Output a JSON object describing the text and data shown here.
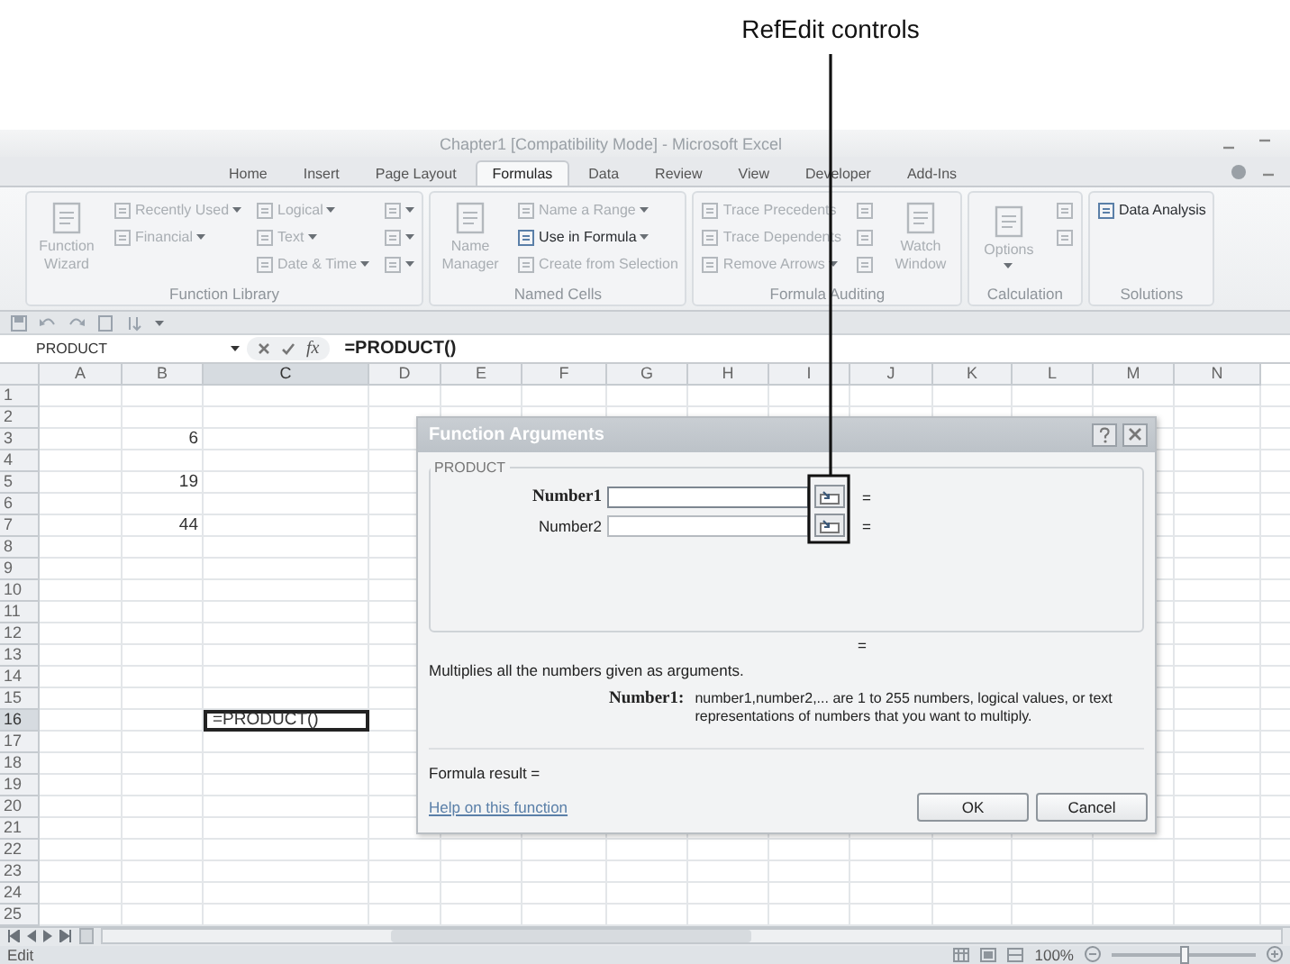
{
  "annotation": {
    "text": "RefEdit controls"
  },
  "window": {
    "title": "Chapter1  [Compatibility Mode] - Microsoft Excel"
  },
  "ribbon_tabs": [
    {
      "label": "Home",
      "selected": false
    },
    {
      "label": "Insert",
      "selected": false
    },
    {
      "label": "Page Layout",
      "selected": false
    },
    {
      "label": "Formulas",
      "selected": true
    },
    {
      "label": "Data",
      "selected": false
    },
    {
      "label": "Review",
      "selected": false
    },
    {
      "label": "View",
      "selected": false
    },
    {
      "label": "Developer",
      "selected": false
    },
    {
      "label": "Add-Ins",
      "selected": false
    }
  ],
  "ribbon_groups": [
    {
      "label": "Function Library",
      "items": [
        {
          "kind": "large",
          "label": "Function Wizard",
          "disabled": true,
          "dropdown": false
        },
        {
          "kind": "small",
          "label": "Recently Used",
          "disabled": true,
          "dropdown": true
        },
        {
          "kind": "small",
          "label": "Financial",
          "disabled": true,
          "dropdown": true
        },
        {
          "kind": "spacer"
        },
        {
          "kind": "small",
          "label": "Logical",
          "disabled": true,
          "dropdown": true
        },
        {
          "kind": "small",
          "label": "Text",
          "disabled": true,
          "dropdown": true
        },
        {
          "kind": "small",
          "label": "Date & Time",
          "disabled": true,
          "dropdown": true
        },
        {
          "kind": "icon",
          "disabled": true,
          "dropdown": true
        },
        {
          "kind": "icon",
          "disabled": true,
          "dropdown": true
        },
        {
          "kind": "icon",
          "disabled": true,
          "dropdown": true
        }
      ]
    },
    {
      "label": "Named Cells",
      "items": [
        {
          "kind": "large",
          "label": "Name Manager",
          "disabled": true,
          "dropdown": false
        },
        {
          "kind": "small",
          "label": "Name a Range",
          "disabled": true,
          "dropdown": true
        },
        {
          "kind": "small",
          "label": "Use in Formula",
          "disabled": false,
          "dropdown": true
        },
        {
          "kind": "small",
          "label": "Create from Selection",
          "disabled": true,
          "dropdown": false
        }
      ]
    },
    {
      "label": "Formula Auditing",
      "items": [
        {
          "kind": "small",
          "label": "Trace Precedents",
          "disabled": true,
          "dropdown": false
        },
        {
          "kind": "small",
          "label": "Trace Dependents",
          "disabled": true,
          "dropdown": false
        },
        {
          "kind": "small",
          "label": "Remove Arrows",
          "disabled": true,
          "dropdown": true
        },
        {
          "kind": "icon",
          "disabled": true,
          "dropdown": false
        },
        {
          "kind": "icon",
          "disabled": true,
          "dropdown": false
        },
        {
          "kind": "icon",
          "disabled": true,
          "dropdown": false
        },
        {
          "kind": "large",
          "label": "Watch Window",
          "disabled": true,
          "dropdown": false
        }
      ]
    },
    {
      "label": "Calculation",
      "items": [
        {
          "kind": "large",
          "label": "Options",
          "disabled": true,
          "dropdown": true
        },
        {
          "kind": "icon",
          "disabled": true,
          "dropdown": false
        },
        {
          "kind": "icon",
          "disabled": true,
          "dropdown": false
        }
      ]
    },
    {
      "label": "Solutions",
      "items": [
        {
          "kind": "small",
          "label": "Data Analysis",
          "disabled": false,
          "dropdown": false
        }
      ]
    }
  ],
  "formula_bar": {
    "name_box": "PRODUCT",
    "function_symbol": "fx",
    "formula": "=PRODUCT()"
  },
  "sheet": {
    "columns": [
      "A",
      "B",
      "C",
      "D",
      "E",
      "F",
      "G",
      "H",
      "I",
      "J",
      "K",
      "L",
      "M",
      "N"
    ],
    "rows": [
      {
        "label": "1"
      },
      {
        "label": "2"
      },
      {
        "label": "3",
        "column_b": {
          "value": "6",
          "selected": false
        }
      },
      {
        "label": "4"
      },
      {
        "label": "5",
        "column_b": {
          "value": "19",
          "selected": false
        }
      },
      {
        "label": "6"
      },
      {
        "label": "7",
        "column_b": {
          "value": "44",
          "selected": false
        }
      },
      {
        "label": "8"
      },
      {
        "label": "9"
      },
      {
        "label": "10"
      },
      {
        "label": "11"
      },
      {
        "label": "12"
      },
      {
        "label": "13"
      },
      {
        "label": "14"
      },
      {
        "label": "15"
      },
      {
        "label": "16",
        "column_c": {
          "value": "=PRODUCT()",
          "selected": true
        }
      },
      {
        "label": "17"
      },
      {
        "label": "18"
      },
      {
        "label": "19"
      },
      {
        "label": "20"
      },
      {
        "label": "21"
      },
      {
        "label": "22"
      },
      {
        "label": "23"
      },
      {
        "label": "24"
      },
      {
        "label": "25"
      }
    ]
  },
  "dialog": {
    "title": "Function Arguments",
    "function_name": "PRODUCT",
    "arguments": [
      {
        "label": "Number1",
        "focused": true,
        "equals": "="
      },
      {
        "label": "Number2",
        "focused": false,
        "equals": "="
      }
    ],
    "result_equals": "=",
    "description": "Multiplies all the numbers given as arguments.",
    "argument_help": {
      "label": "Number1:",
      "text": "number1,number2,... are 1 to 255 numbers, logical values, or text representations of numbers that you want to multiply."
    },
    "formula_result": "Formula result =",
    "help_link": "Help on this function",
    "buttons": [
      "OK",
      "Cancel"
    ]
  },
  "status_bar": {
    "mode": "Edit",
    "zoom": "100%",
    "zoom_slider": {
      "level": 0.5
    }
  }
}
